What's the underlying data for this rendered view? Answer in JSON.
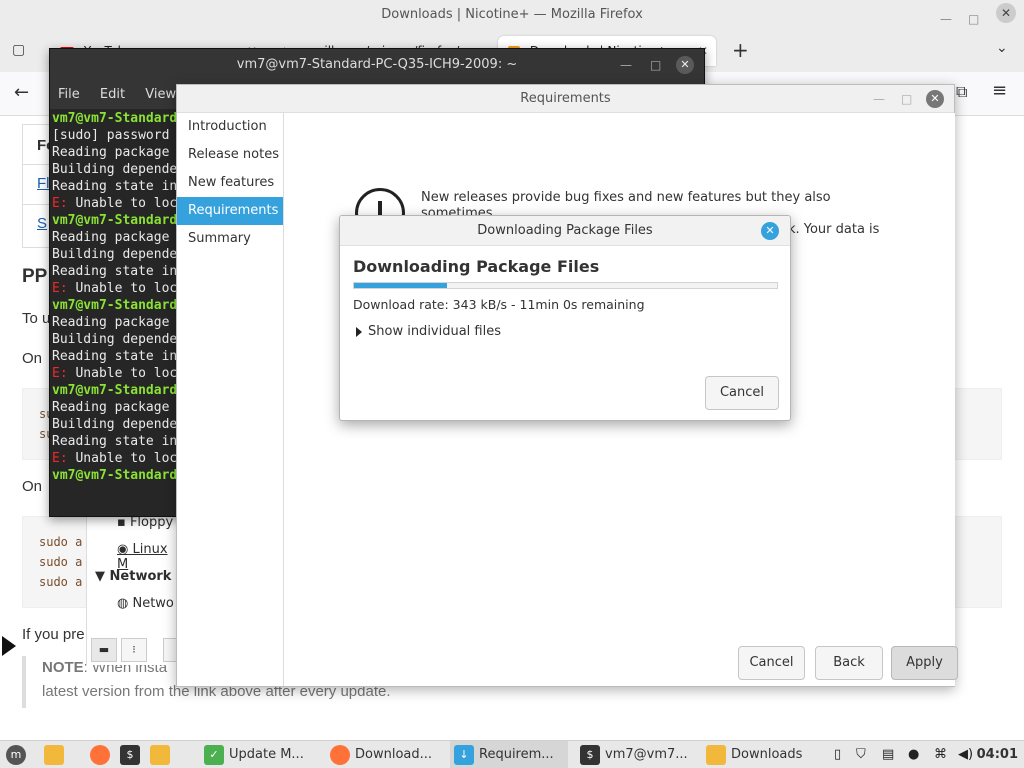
{
  "firefox": {
    "window_title": "Downloads | Nicotine+ — Mozilla Firefox",
    "tabs": [
      {
        "label": "YouTube"
      },
      {
        "label": "mozilla.org/privacy/firefox/"
      },
      {
        "label": "Downloads | Nicotine+"
      }
    ],
    "page": {
      "table_cell_1": "Fl",
      "table_cell_2": "S",
      "table_head": "Fo",
      "heading_ppa": "PP",
      "para_to": "To u",
      "para_on1": "On",
      "code_s1": "su",
      "code_s2": "su",
      "para_on2": "On",
      "code_lines": [
        "sudo a",
        "sudo a",
        "sudo a"
      ],
      "para_prefer": "If you pre",
      "note_label": "NOTE",
      "note_text": ": When insta",
      "note_line2": "latest version from the link above after every update."
    }
  },
  "terminal": {
    "title": "vm7@vm7-Standard-PC-Q35-ICH9-2009: ~",
    "menu": [
      "File",
      "Edit",
      "View"
    ],
    "lines": [
      {
        "type": "prompt",
        "text": "vm7@vm7-Standard"
      },
      {
        "type": "text",
        "text": "[sudo] password"
      },
      {
        "type": "text",
        "text": "Reading package"
      },
      {
        "type": "text",
        "text": "Building depende"
      },
      {
        "type": "text",
        "text": "Reading state in"
      },
      {
        "type": "error",
        "prefix": "E:",
        "text": " Unable to loc"
      },
      {
        "type": "prompt",
        "text": "vm7@vm7-Standard"
      },
      {
        "type": "text",
        "text": "Reading package"
      },
      {
        "type": "text",
        "text": "Building depende"
      },
      {
        "type": "text",
        "text": "Reading state in"
      },
      {
        "type": "error",
        "prefix": "E:",
        "text": " Unable to loc"
      },
      {
        "type": "prompt",
        "text": "vm7@vm7-Standard"
      },
      {
        "type": "text",
        "text": "Reading package"
      },
      {
        "type": "text",
        "text": "Building depende"
      },
      {
        "type": "text",
        "text": "Reading state in"
      },
      {
        "type": "error",
        "prefix": "E:",
        "text": " Unable to loc"
      },
      {
        "type": "prompt",
        "text": "vm7@vm7-Standard"
      },
      {
        "type": "text",
        "text": "Reading package"
      },
      {
        "type": "text",
        "text": "Building depende"
      },
      {
        "type": "text",
        "text": "Reading state in"
      },
      {
        "type": "error",
        "prefix": "E:",
        "text": " Unable to loc"
      },
      {
        "type": "prompt",
        "text": "vm7@vm7-Standard"
      }
    ]
  },
  "file_manager_peek": {
    "floppy": "Floppy",
    "linux_m": "Linux M",
    "network_header": "Network",
    "network_item": "Netwo"
  },
  "update_manager": {
    "title": "Requirements",
    "sidebar": [
      "Introduction",
      "Release notes",
      "New features",
      "Requirements",
      "Summary"
    ],
    "active_index": 3,
    "info_line1": "New releases provide bug fixes and new features but they also sometimes",
    "info_line2": "introduce new issues. Upgrading always represents a risk. Your data is safe",
    "buttons": {
      "cancel": "Cancel",
      "back": "Back",
      "apply": "Apply"
    }
  },
  "download_dialog": {
    "title": "Downloading Package Files",
    "heading": "Downloading Package Files",
    "progress_fraction": 0.22,
    "rate_text": "Download rate: 343 kB/s - 11min 0s remaining",
    "expander": "Show individual files",
    "cancel_label": "Cancel"
  },
  "taskbar": {
    "items": [
      {
        "label": "Update M...",
        "icon": "shield-icon",
        "color": "#4caf50"
      },
      {
        "label": "Download...",
        "icon": "firefox-icon",
        "color": "#ff7139"
      },
      {
        "label": "Requirem...",
        "icon": "download-arrow-icon",
        "color": "#35a2dd"
      },
      {
        "label": "vm7@vm7...",
        "icon": "terminal-icon",
        "color": "#333333"
      },
      {
        "label": "Downloads",
        "icon": "folder-icon",
        "color": "#f2b83b"
      }
    ],
    "clock": "04:01"
  },
  "colors": {
    "accent": "#35a2dd",
    "terminal_bg": "#262626",
    "prompt": "#8ae234",
    "error": "#ef2929"
  }
}
